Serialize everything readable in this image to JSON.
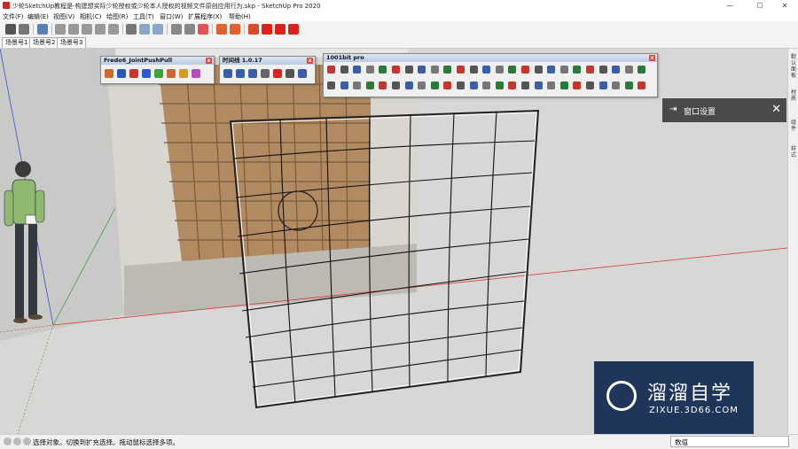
{
  "window": {
    "title": "少轮SketchUp教程是-构建想实际少轮授权或少轮本人授权的视频文件原创应用行为.skp - SketchUp Pro 2020",
    "minimize": "—",
    "maximize": "☐",
    "close": "✕"
  },
  "menu": {
    "items": [
      "文件(F)",
      "编辑(E)",
      "视图(V)",
      "相机(C)",
      "绘图(R)",
      "工具(T)",
      "窗口(W)",
      "扩展程序(X)",
      "帮助(H)"
    ]
  },
  "scenes": {
    "tabs": [
      "场景号1",
      "场景号2",
      "场景号3"
    ]
  },
  "panels": {
    "fredo": {
      "title": "Fredo6_JointPushPull",
      "close": "x"
    },
    "plugin2": {
      "title": "时间线 1.0.17",
      "close": "x"
    },
    "bit1001": {
      "title": "1001bit pro",
      "close": "x"
    }
  },
  "tray": {
    "tabs": [
      "默认面板",
      "材质",
      "组件",
      "样式"
    ]
  },
  "window_settings": {
    "arrow": "⇥",
    "title": "窗口设置",
    "close": "✕"
  },
  "status": {
    "message": "选择对象。切换到扩充选择。拖动鼠标选择多项。",
    "vcb_label": "数值"
  },
  "watermark": {
    "brand_cn": "溜溜自学",
    "brand_en": "ZIXUE.3D66.COM"
  },
  "colors": {
    "accent_red": "#d8231f",
    "dark_panel": "#4a4a4a",
    "watermark_bg": "#1f3559"
  }
}
